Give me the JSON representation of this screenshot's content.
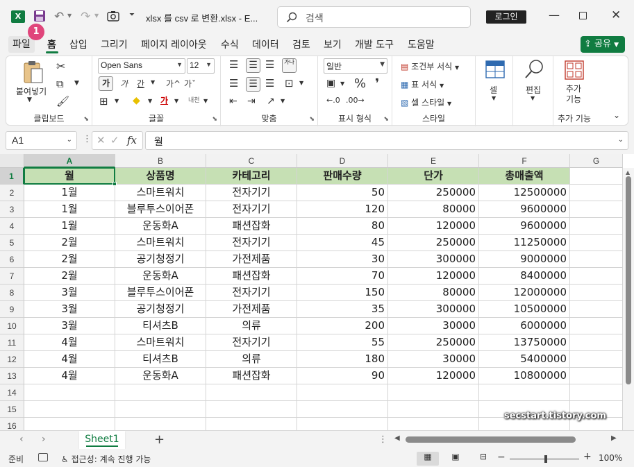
{
  "titlebar": {
    "app_logo": "X",
    "title": "xlsx 를 csv 로 변환.xlsx  -  E...",
    "search_placeholder": "검색",
    "login_label": "로그인",
    "badge": "1"
  },
  "tabs": [
    "파일",
    "홈",
    "삽입",
    "그리기",
    "페이지 레이아웃",
    "수식",
    "데이터",
    "검토",
    "보기",
    "개발 도구",
    "도움말"
  ],
  "active_tab": "홈",
  "share_label": "공유",
  "ribbon": {
    "clipboard": {
      "paste_label": "붙여넣기",
      "group_label": "클립보드"
    },
    "font": {
      "font_name": "Open Sans",
      "font_size": "12",
      "group_label": "글꼴",
      "bold_glyph": "가",
      "italic_glyph": "가",
      "underline_glyph": "간",
      "grow_glyph": "가^",
      "shrink_glyph": "가ˇ",
      "fill_glyph": "◆",
      "color_glyph": "가",
      "phonetic_glyph": "내천"
    },
    "alignment": {
      "group_label": "맞춤",
      "wrap_glyph": "가나"
    },
    "number": {
      "format": "일반",
      "group_label": "표시 형식",
      "percent": "%",
      "comma": "❜"
    },
    "styles": {
      "conditional": "조건부 서식",
      "table": "표 서식",
      "cell_style": "셀 스타일",
      "group_label": "스타일"
    },
    "cells": {
      "label": "셀"
    },
    "editing": {
      "label": "편집"
    },
    "addins": {
      "label": "추가\n기능",
      "group_label": "추가 기능"
    }
  },
  "formula_bar": {
    "name_box": "A1",
    "fx": "fx",
    "formula": "월"
  },
  "columns": [
    "A",
    "B",
    "C",
    "D",
    "E",
    "F",
    "G"
  ],
  "row_numbers": [
    "1",
    "2",
    "3",
    "4",
    "5",
    "6",
    "7",
    "8",
    "9",
    "10",
    "11",
    "12",
    "13",
    "14",
    "15",
    "16"
  ],
  "table": {
    "headers": [
      "월",
      "상품명",
      "카테고리",
      "판매수량",
      "단가",
      "총매출액"
    ],
    "rows": [
      [
        "1월",
        "스마트워치",
        "전자기기",
        "50",
        "250000",
        "12500000"
      ],
      [
        "1월",
        "블루투스이어폰",
        "전자기기",
        "120",
        "80000",
        "9600000"
      ],
      [
        "1월",
        "운동화A",
        "패션잡화",
        "80",
        "120000",
        "9600000"
      ],
      [
        "2월",
        "스마트워치",
        "전자기기",
        "45",
        "250000",
        "11250000"
      ],
      [
        "2월",
        "공기청정기",
        "가전제품",
        "30",
        "300000",
        "9000000"
      ],
      [
        "2월",
        "운동화A",
        "패션잡화",
        "70",
        "120000",
        "8400000"
      ],
      [
        "3월",
        "블루투스이어폰",
        "전자기기",
        "150",
        "80000",
        "12000000"
      ],
      [
        "3월",
        "공기청정기",
        "가전제품",
        "35",
        "300000",
        "10500000"
      ],
      [
        "3월",
        "티셔츠B",
        "의류",
        "200",
        "30000",
        "6000000"
      ],
      [
        "4월",
        "스마트워치",
        "전자기기",
        "55",
        "250000",
        "13750000"
      ],
      [
        "4월",
        "티셔츠B",
        "의류",
        "180",
        "30000",
        "5400000"
      ],
      [
        "4월",
        "운동화A",
        "패션잡화",
        "90",
        "120000",
        "10800000"
      ]
    ]
  },
  "watermark": "secstart.tistory.com",
  "sheet_tab": "Sheet1",
  "status": {
    "ready": "준비",
    "accessibility": "접근성: 계속 진행 가능",
    "zoom": "100%"
  },
  "colors": {
    "accent": "#107c41",
    "header_fill": "#c6e0b4",
    "badge": "#e0457b"
  }
}
